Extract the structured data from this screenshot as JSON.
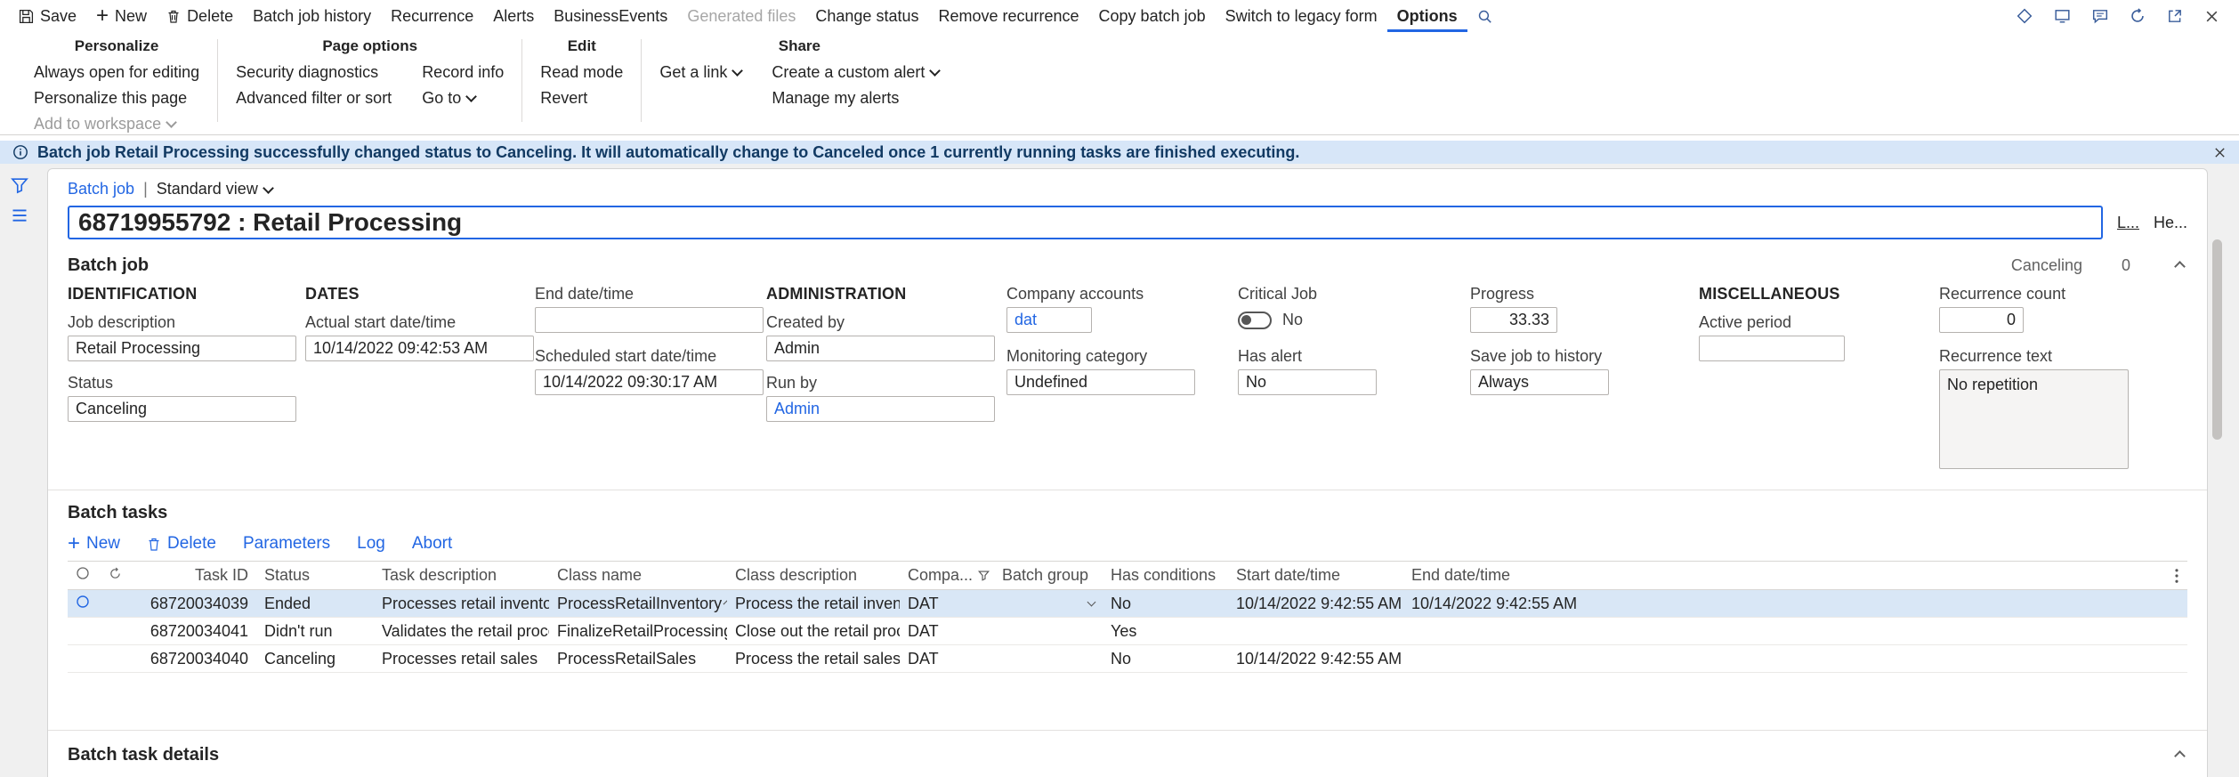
{
  "action_bar": {
    "items": [
      {
        "label": "Save"
      },
      {
        "label": "New"
      },
      {
        "label": "Delete"
      },
      {
        "label": "Batch job history"
      },
      {
        "label": "Recurrence"
      },
      {
        "label": "Alerts"
      },
      {
        "label": "BusinessEvents"
      },
      {
        "label": "Generated files"
      },
      {
        "label": "Change status"
      },
      {
        "label": "Remove recurrence"
      },
      {
        "label": "Copy batch job"
      },
      {
        "label": "Switch to legacy form"
      },
      {
        "label": "Options"
      }
    ]
  },
  "ribbon": {
    "personalize": {
      "title": "Personalize",
      "item1": "Always open for editing",
      "item2": "Personalize this page",
      "item3": "Add to workspace"
    },
    "page_options": {
      "title": "Page options",
      "item1": "Security diagnostics",
      "item2": "Advanced filter or sort",
      "item3": "Record info",
      "item4": "Go to"
    },
    "edit": {
      "title": "Edit",
      "item1": "Read mode",
      "item2": "Revert"
    },
    "share": {
      "title": "Share",
      "item1": "Get a link",
      "item2": "Create a custom alert",
      "item3": "Manage my alerts"
    }
  },
  "message_bar": {
    "text": "Batch job Retail Processing successfully changed status to Canceling. It will automatically change to Canceled once 1 currently running tasks are finished executing."
  },
  "page": {
    "breadcrumb_entity": "Batch job",
    "breadcrumb_separator": "|",
    "view_selector": "Standard view",
    "title": "68719955792 : Retail Processing",
    "button_lines": "L...",
    "button_header": "He..."
  },
  "batch_job": {
    "section_title": "Batch job",
    "summary_status": "Canceling",
    "summary_count": "0",
    "group_identification": "IDENTIFICATION",
    "group_dates": "DATES",
    "group_administration": "ADMINISTRATION",
    "group_miscellaneous": "MISCELLANEOUS",
    "fields": {
      "job_description": {
        "label": "Job description",
        "value": "Retail Processing"
      },
      "status": {
        "label": "Status",
        "value": "Canceling"
      },
      "actual_start": {
        "label": "Actual start date/time",
        "value": "10/14/2022 09:42:53 AM"
      },
      "end_datetime": {
        "label": "End date/time",
        "value": ""
      },
      "scheduled_start": {
        "label": "Scheduled start date/time",
        "value": "10/14/2022 09:30:17 AM"
      },
      "created_by": {
        "label": "Created by",
        "value": "Admin"
      },
      "run_by": {
        "label": "Run by",
        "value": "Admin"
      },
      "company_accounts": {
        "label": "Company accounts",
        "value": "dat"
      },
      "monitoring_category": {
        "label": "Monitoring category",
        "value": "Undefined"
      },
      "critical_job": {
        "label": "Critical Job",
        "value": "No"
      },
      "has_alert": {
        "label": "Has alert",
        "value": "No"
      },
      "progress": {
        "label": "Progress",
        "value": "33.33"
      },
      "save_job_to_history": {
        "label": "Save job to history",
        "value": "Always"
      },
      "active_period": {
        "label": "Active period",
        "value": ""
      },
      "recurrence_count": {
        "label": "Recurrence count",
        "value": "0"
      },
      "recurrence_text": {
        "label": "Recurrence text",
        "value": "No repetition"
      }
    }
  },
  "batch_tasks": {
    "section_title": "Batch tasks",
    "toolbar": {
      "new": "New",
      "delete": "Delete",
      "parameters": "Parameters",
      "log": "Log",
      "abort": "Abort"
    },
    "columns": {
      "task_id": "Task ID",
      "status": "Status",
      "task_description": "Task description",
      "class_name": "Class name",
      "class_description": "Class description",
      "company": "Compa...",
      "batch_group": "Batch group",
      "has_conditions": "Has conditions",
      "start": "Start date/time",
      "end": "End date/time"
    },
    "rows": [
      {
        "task_id": "68720034039",
        "status": "Ended",
        "task_description": "Processes retail inventory",
        "class_name": "ProcessRetailInventory",
        "class_description": "Process the retail inventory",
        "company": "DAT",
        "batch_group": "",
        "has_conditions": "No",
        "start": "10/14/2022 9:42:55 AM",
        "end": "10/14/2022 9:42:55 AM"
      },
      {
        "task_id": "68720034041",
        "status": "Didn't run",
        "task_description": "Validates the retail process",
        "class_name": "FinalizeRetailProcessing",
        "class_description": "Close out the retail proce...",
        "company": "DAT",
        "batch_group": "",
        "has_conditions": "Yes",
        "start": "",
        "end": ""
      },
      {
        "task_id": "68720034040",
        "status": "Canceling",
        "task_description": "Processes retail sales",
        "class_name": "ProcessRetailSales",
        "class_description": "Process the retail sales",
        "company": "DAT",
        "batch_group": "",
        "has_conditions": "No",
        "start": "10/14/2022 9:42:55 AM",
        "end": ""
      }
    ]
  },
  "batch_task_details": {
    "section_title": "Batch task details"
  }
}
